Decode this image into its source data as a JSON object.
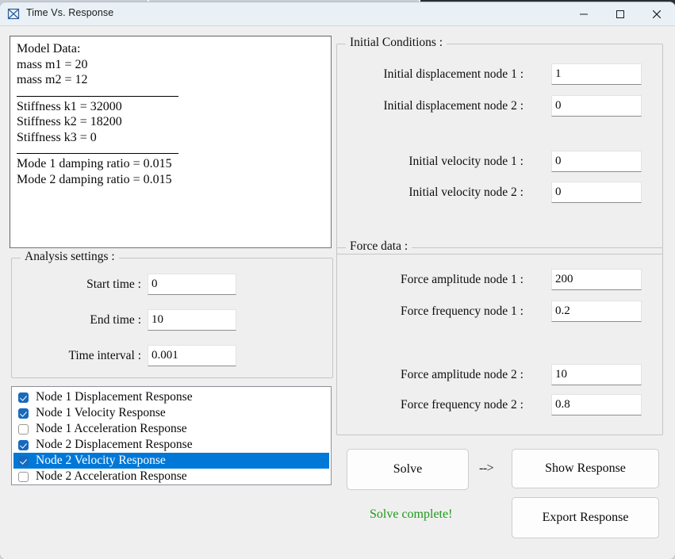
{
  "window": {
    "title": "Time Vs. Response",
    "app_icon": "plot-window-icon",
    "caption": {
      "minimize": "minimize-icon",
      "maximize": "maximize-icon",
      "close": "close-icon"
    }
  },
  "model_data": {
    "lines_group_1": [
      "Model Data:",
      "mass m1 = 20",
      "mass m2 = 12"
    ],
    "lines_group_2": [
      "Stiffness k1 = 32000",
      "Stiffness k2 = 18200",
      "Stiffness k3 = 0"
    ],
    "lines_group_3": [
      "Mode 1 damping ratio = 0.015",
      "Mode 2 damping ratio = 0.015"
    ]
  },
  "initial_conditions": {
    "title": "Initial Conditions :",
    "fields": [
      {
        "label": "Initial displacement node 1 :",
        "value": "1"
      },
      {
        "label": "Initial displacement node 2 :",
        "value": "0"
      },
      {
        "label": "Initial velocity node 1 :",
        "value": "0"
      },
      {
        "label": "Initial velocity node 2 :",
        "value": "0"
      }
    ]
  },
  "analysis_settings": {
    "title": "Analysis settings :",
    "fields": [
      {
        "label": "Start time :",
        "value": "0"
      },
      {
        "label": "End time :",
        "value": "10"
      },
      {
        "label": "Time interval :",
        "value": "0.001"
      }
    ]
  },
  "force_data": {
    "title": "Force data :",
    "fields": [
      {
        "label": "Force amplitude node 1 :",
        "value": "200"
      },
      {
        "label": "Force frequency node 1 :",
        "value": "0.2"
      },
      {
        "label": "Force amplitude node 2 :",
        "value": "10"
      },
      {
        "label": "Force frequency node 2 :",
        "value": "0.8"
      }
    ]
  },
  "response_list": [
    {
      "label": "Node 1 Displacement Response",
      "checked": true,
      "selected": false
    },
    {
      "label": "Node 1 Velocity Response",
      "checked": true,
      "selected": false
    },
    {
      "label": "Node 1 Acceleration Response",
      "checked": false,
      "selected": false
    },
    {
      "label": "Node 2 Displacement Response",
      "checked": true,
      "selected": false
    },
    {
      "label": "Node 2 Velocity Response",
      "checked": true,
      "selected": true
    },
    {
      "label": "Node 2 Acceleration Response",
      "checked": false,
      "selected": false
    }
  ],
  "actions": {
    "solve_label": "Solve",
    "arrow": "-->",
    "show_response_label": "Show Response",
    "export_response_label": "Export Response",
    "status_text": "Solve complete!",
    "status_color": "#1a9a1a"
  }
}
